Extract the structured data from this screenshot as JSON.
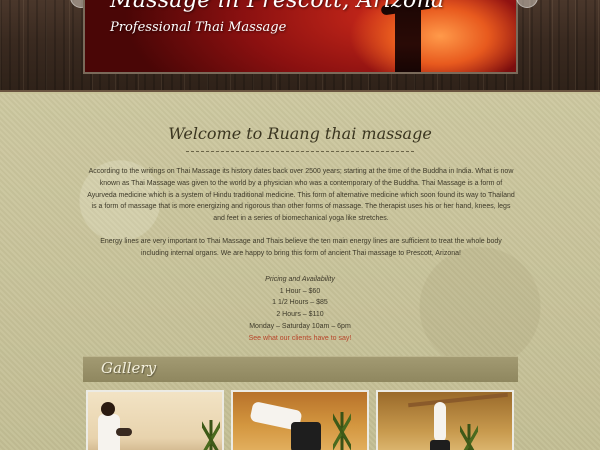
{
  "header": {
    "banner_title": "Massage in Prescott, Arizona",
    "banner_subtitle": "Professional Thai Massage"
  },
  "welcome": {
    "title": "Welcome to Ruang thai massage",
    "paragraph1": "According to the writings on Thai Massage its history dates back over 2500 years; starting at the time of the Buddha in India. What is now known as Thai Massage was given to the world by a physician who was a contemporary of the Buddha. Thai Massage is a form of Ayurveda medicine which is a system of Hindu traditional medicine. This form of alternative medicine which soon found its way to Thailand is a form of massage that is more energizing and rigorous than other forms of massage. The therapist uses his or her hand, knees, legs and feet in a series of biomechanical yoga like stretches.",
    "paragraph2": "Energy lines are very important to Thai Massage and Thais believe the ten main energy lines are sufficient to treat the whole body including internal organs. We are happy to bring this form of ancient Thai massage to Prescott, Arizona!"
  },
  "pricing": {
    "heading": "Pricing and Availability",
    "line1": "1 Hour – $60",
    "line2": "1 1/2 Hours – $85",
    "line3": "2 Hours – $110",
    "hours": "Monday – Saturday 10am – 6pm",
    "link": "See what our clients have to say!"
  },
  "gallery": {
    "title": "Gallery"
  },
  "colors": {
    "link": "#b8452a",
    "banner_red": "#8a1010",
    "gallery_bar": "#9a9268"
  }
}
